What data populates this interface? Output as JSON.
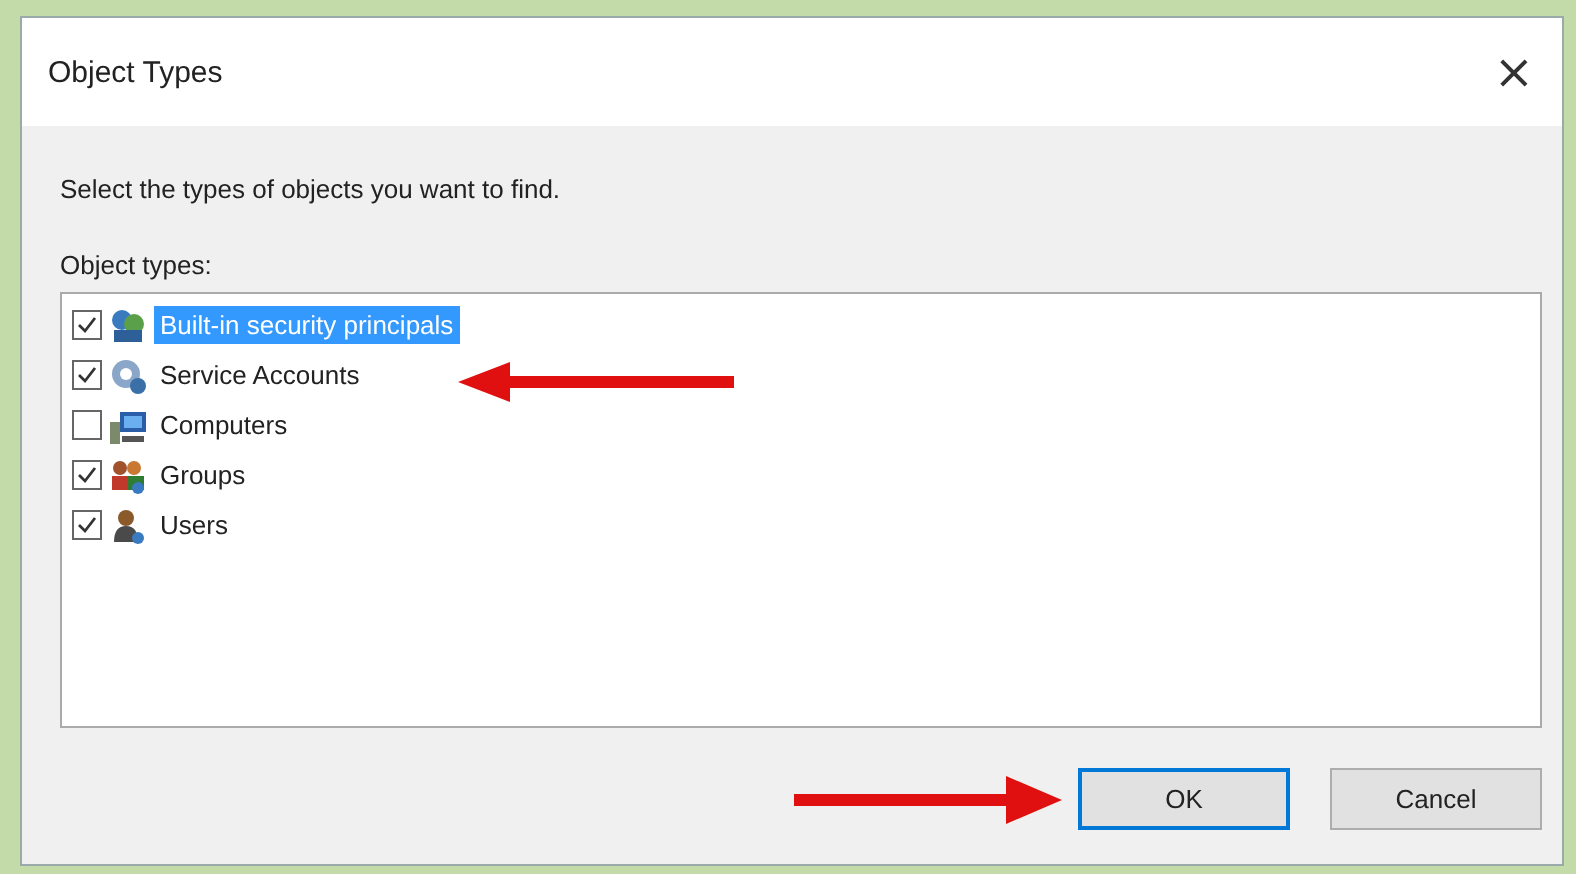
{
  "window": {
    "title": "Object Types",
    "close": "×"
  },
  "prompt": "Select the types of objects you want to find.",
  "list_label": "Object types:",
  "items": [
    {
      "label": "Built-in security principals",
      "kind": "security",
      "checked": true,
      "selected": true
    },
    {
      "label": "Service Accounts",
      "kind": "service",
      "checked": true,
      "selected": false
    },
    {
      "label": "Computers",
      "kind": "computer",
      "checked": false,
      "selected": false
    },
    {
      "label": "Groups",
      "kind": "group",
      "checked": true,
      "selected": false
    },
    {
      "label": "Users",
      "kind": "user",
      "checked": true,
      "selected": false
    }
  ],
  "buttons": [
    {
      "label": "OK",
      "default": true
    },
    {
      "label": "Cancel",
      "default": false
    }
  ]
}
